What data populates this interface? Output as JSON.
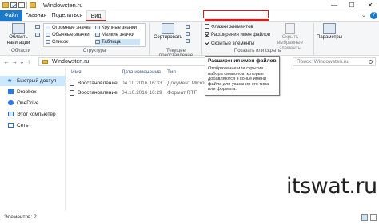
{
  "window": {
    "title": "Windowsten.ru",
    "minimize": "—",
    "maximize": "☐",
    "close": "✕"
  },
  "tabs": {
    "file": "Файл",
    "home": "Главная",
    "share": "Поделиться",
    "view": "Вид"
  },
  "ribbon": {
    "panes": {
      "nav_area_label": "Область\nнавигации",
      "group": "Области"
    },
    "layout": {
      "items": [
        "Огромные значки",
        "Крупные значки",
        "Обычные значки",
        "Мелкие значки",
        "Список",
        "Таблица"
      ],
      "group": "Структура"
    },
    "current_view": {
      "sort_label": "Сортировать",
      "group": "Текущее представление"
    },
    "show_hide": {
      "checkboxes": [
        {
          "label": "Флажки элементов",
          "checked": false
        },
        {
          "label": "Расширения имен файлов",
          "checked": true
        },
        {
          "label": "Скрытые элементы",
          "checked": true
        }
      ],
      "hide_selected": "Скрыть выбранные элементы",
      "group": "Показать или скрыть"
    },
    "options": {
      "label": "Параметры"
    }
  },
  "address": {
    "path": "Windowsten.ru",
    "search_placeholder": "Поиск: Windowsten.ru"
  },
  "nav": [
    {
      "label": "Быстрый доступ",
      "icon": "star-icon",
      "active": true
    },
    {
      "label": "Dropbox",
      "icon": "dropbox-icon",
      "active": false
    },
    {
      "label": "OneDrive",
      "icon": "onedrive-icon",
      "active": false
    },
    {
      "label": "Этот компьютер",
      "icon": "computer-icon",
      "active": false
    },
    {
      "label": "Сеть",
      "icon": "network-icon",
      "active": false
    }
  ],
  "columns": {
    "name": "Имя",
    "date": "Дата изменения",
    "type": "Тип"
  },
  "files": [
    {
      "name": "Восстановление ...",
      "date": "04.10.2016 16:33",
      "type": "Документ Micros"
    },
    {
      "name": "Восстановление ...",
      "date": "04.10.2016 16:29",
      "type": "Формат RTF"
    }
  ],
  "tooltip": {
    "title": "Расширения имен файлов",
    "body": "Отображение или скрытие набора символов, которые добавляются в конце имени файла для указания его типа или формата."
  },
  "watermark": "itswat.ru",
  "status": {
    "items": "Элементов: 2"
  },
  "colors": {
    "accent": "#1979ca",
    "highlight": "#d52020",
    "selection": "#cce8ff"
  }
}
